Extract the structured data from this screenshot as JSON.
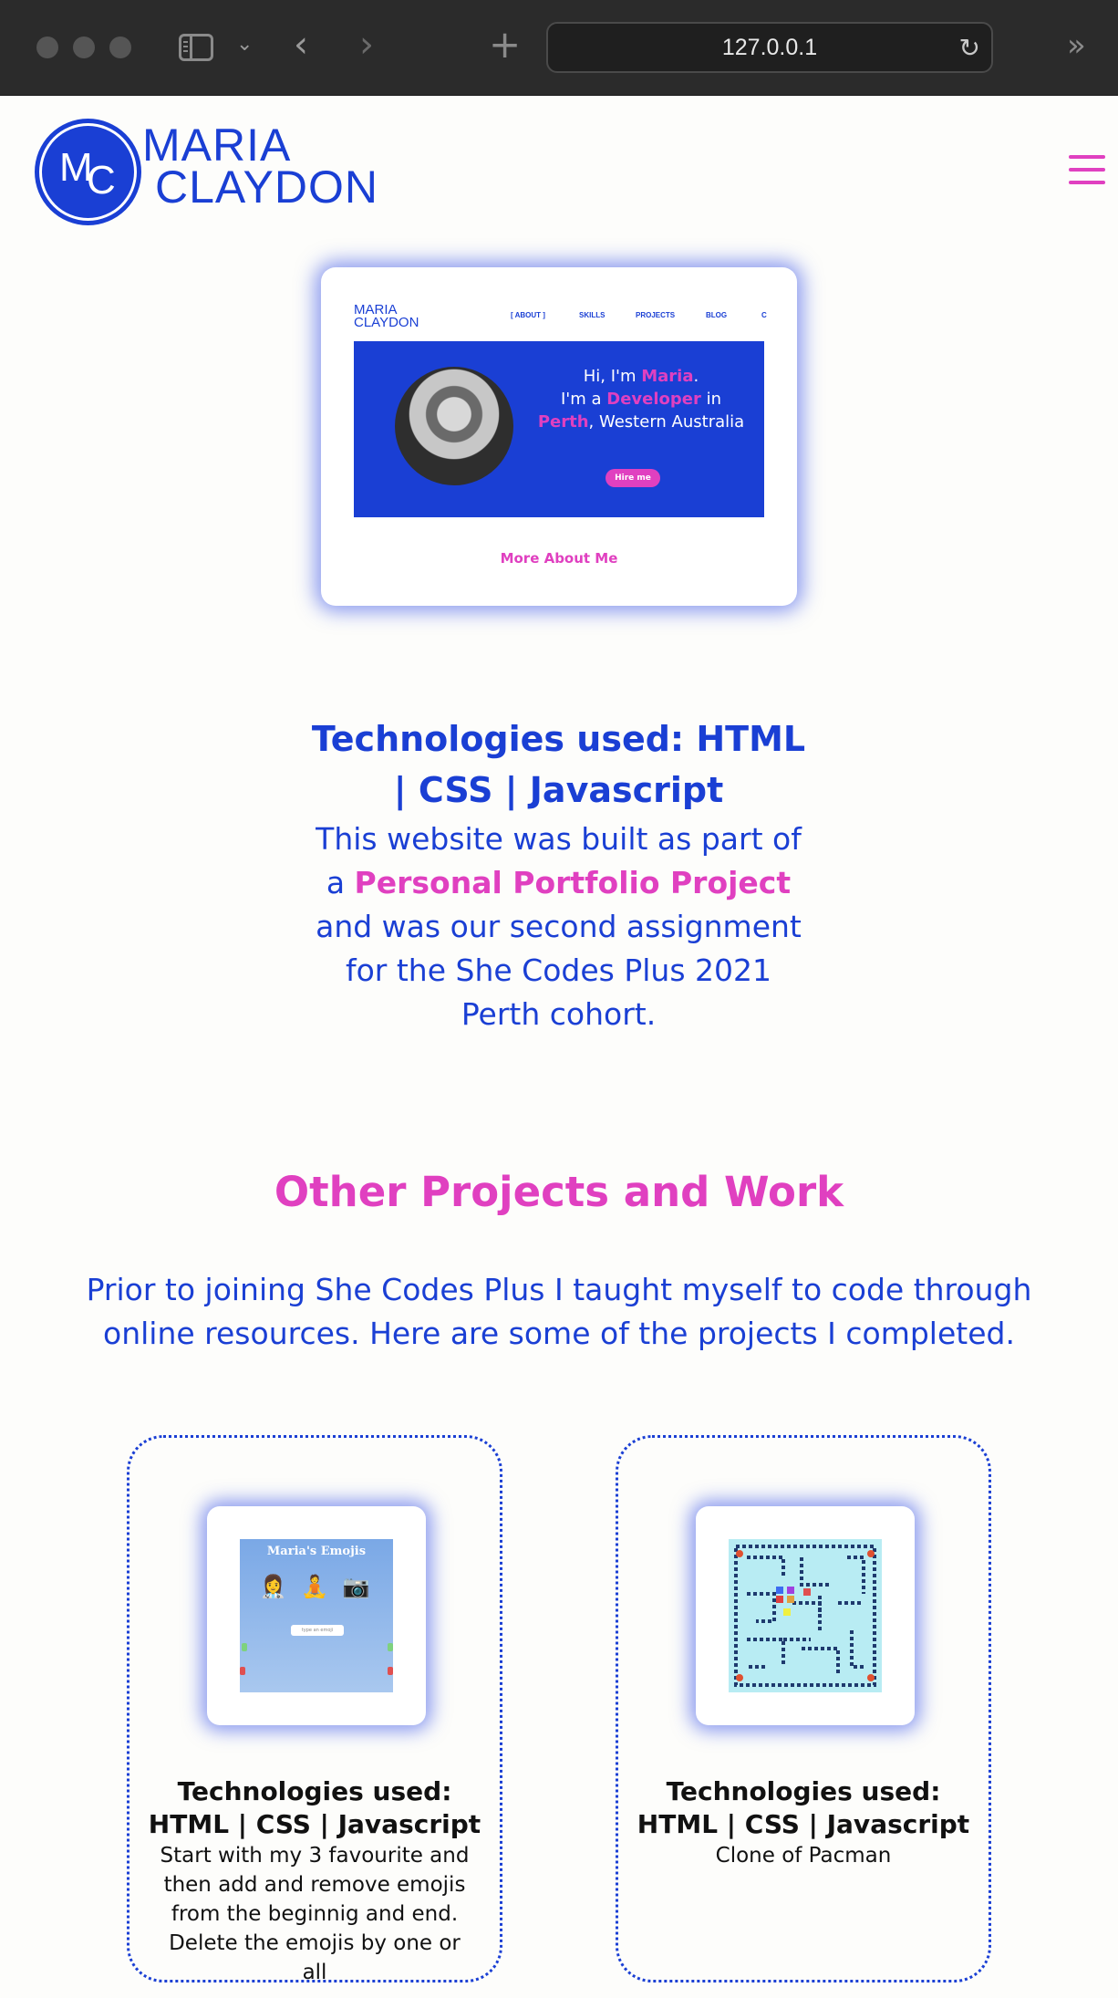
{
  "browser": {
    "url": "127.0.0.1"
  },
  "site": {
    "logo_initial_m": "M",
    "logo_initial_c": "C",
    "logo_line1": "MARIA",
    "logo_line2": "CLAYDON"
  },
  "preview": {
    "logo_line1": "MARIA",
    "logo_line2": "CLAYDON",
    "nav": [
      "[ ABOUT ]",
      "SKILLS",
      "PROJECTS",
      "BLOG",
      "C"
    ],
    "hero_hi": "Hi, I'm ",
    "hero_name": "Maria",
    "hero_dot": ".",
    "hero_im_a": "I'm a ",
    "hero_role": "Developer",
    "hero_in": " in",
    "hero_city": "Perth",
    "hero_region": ", Western Australia",
    "hire_label": "Hire me",
    "more_label": "More About Me"
  },
  "main_project": {
    "tech_heading": "Technologies used: HTML | CSS | Javascript",
    "desc_part1": "This website was built as part of a ",
    "desc_highlight": "Personal Portfolio Project",
    "desc_part2": " and was our second assignment for the She Codes Plus 2021 Perth cohort."
  },
  "other": {
    "heading": "Other Projects and Work",
    "intro": "Prior to joining She Codes Plus I taught myself to code through online resources. Here are some of the projects I completed."
  },
  "projects": [
    {
      "thumb_title": "Maria's Emojis",
      "thumb_emojis": "👩‍⚕ 🧘 📷",
      "thumb_input": "type an emoji",
      "tech": "Technologies used: HTML | CSS | Javascript",
      "desc": "Start with my 3 favourite and then add and remove emojis from the beginnig and end. Delete the emojis by one or all"
    },
    {
      "tech": "Technologies used: HTML | CSS | Javascript",
      "desc": "Clone of Pacman"
    }
  ],
  "colors": {
    "brand_blue": "#1a3fd4",
    "accent_pink": "#e040c0"
  }
}
